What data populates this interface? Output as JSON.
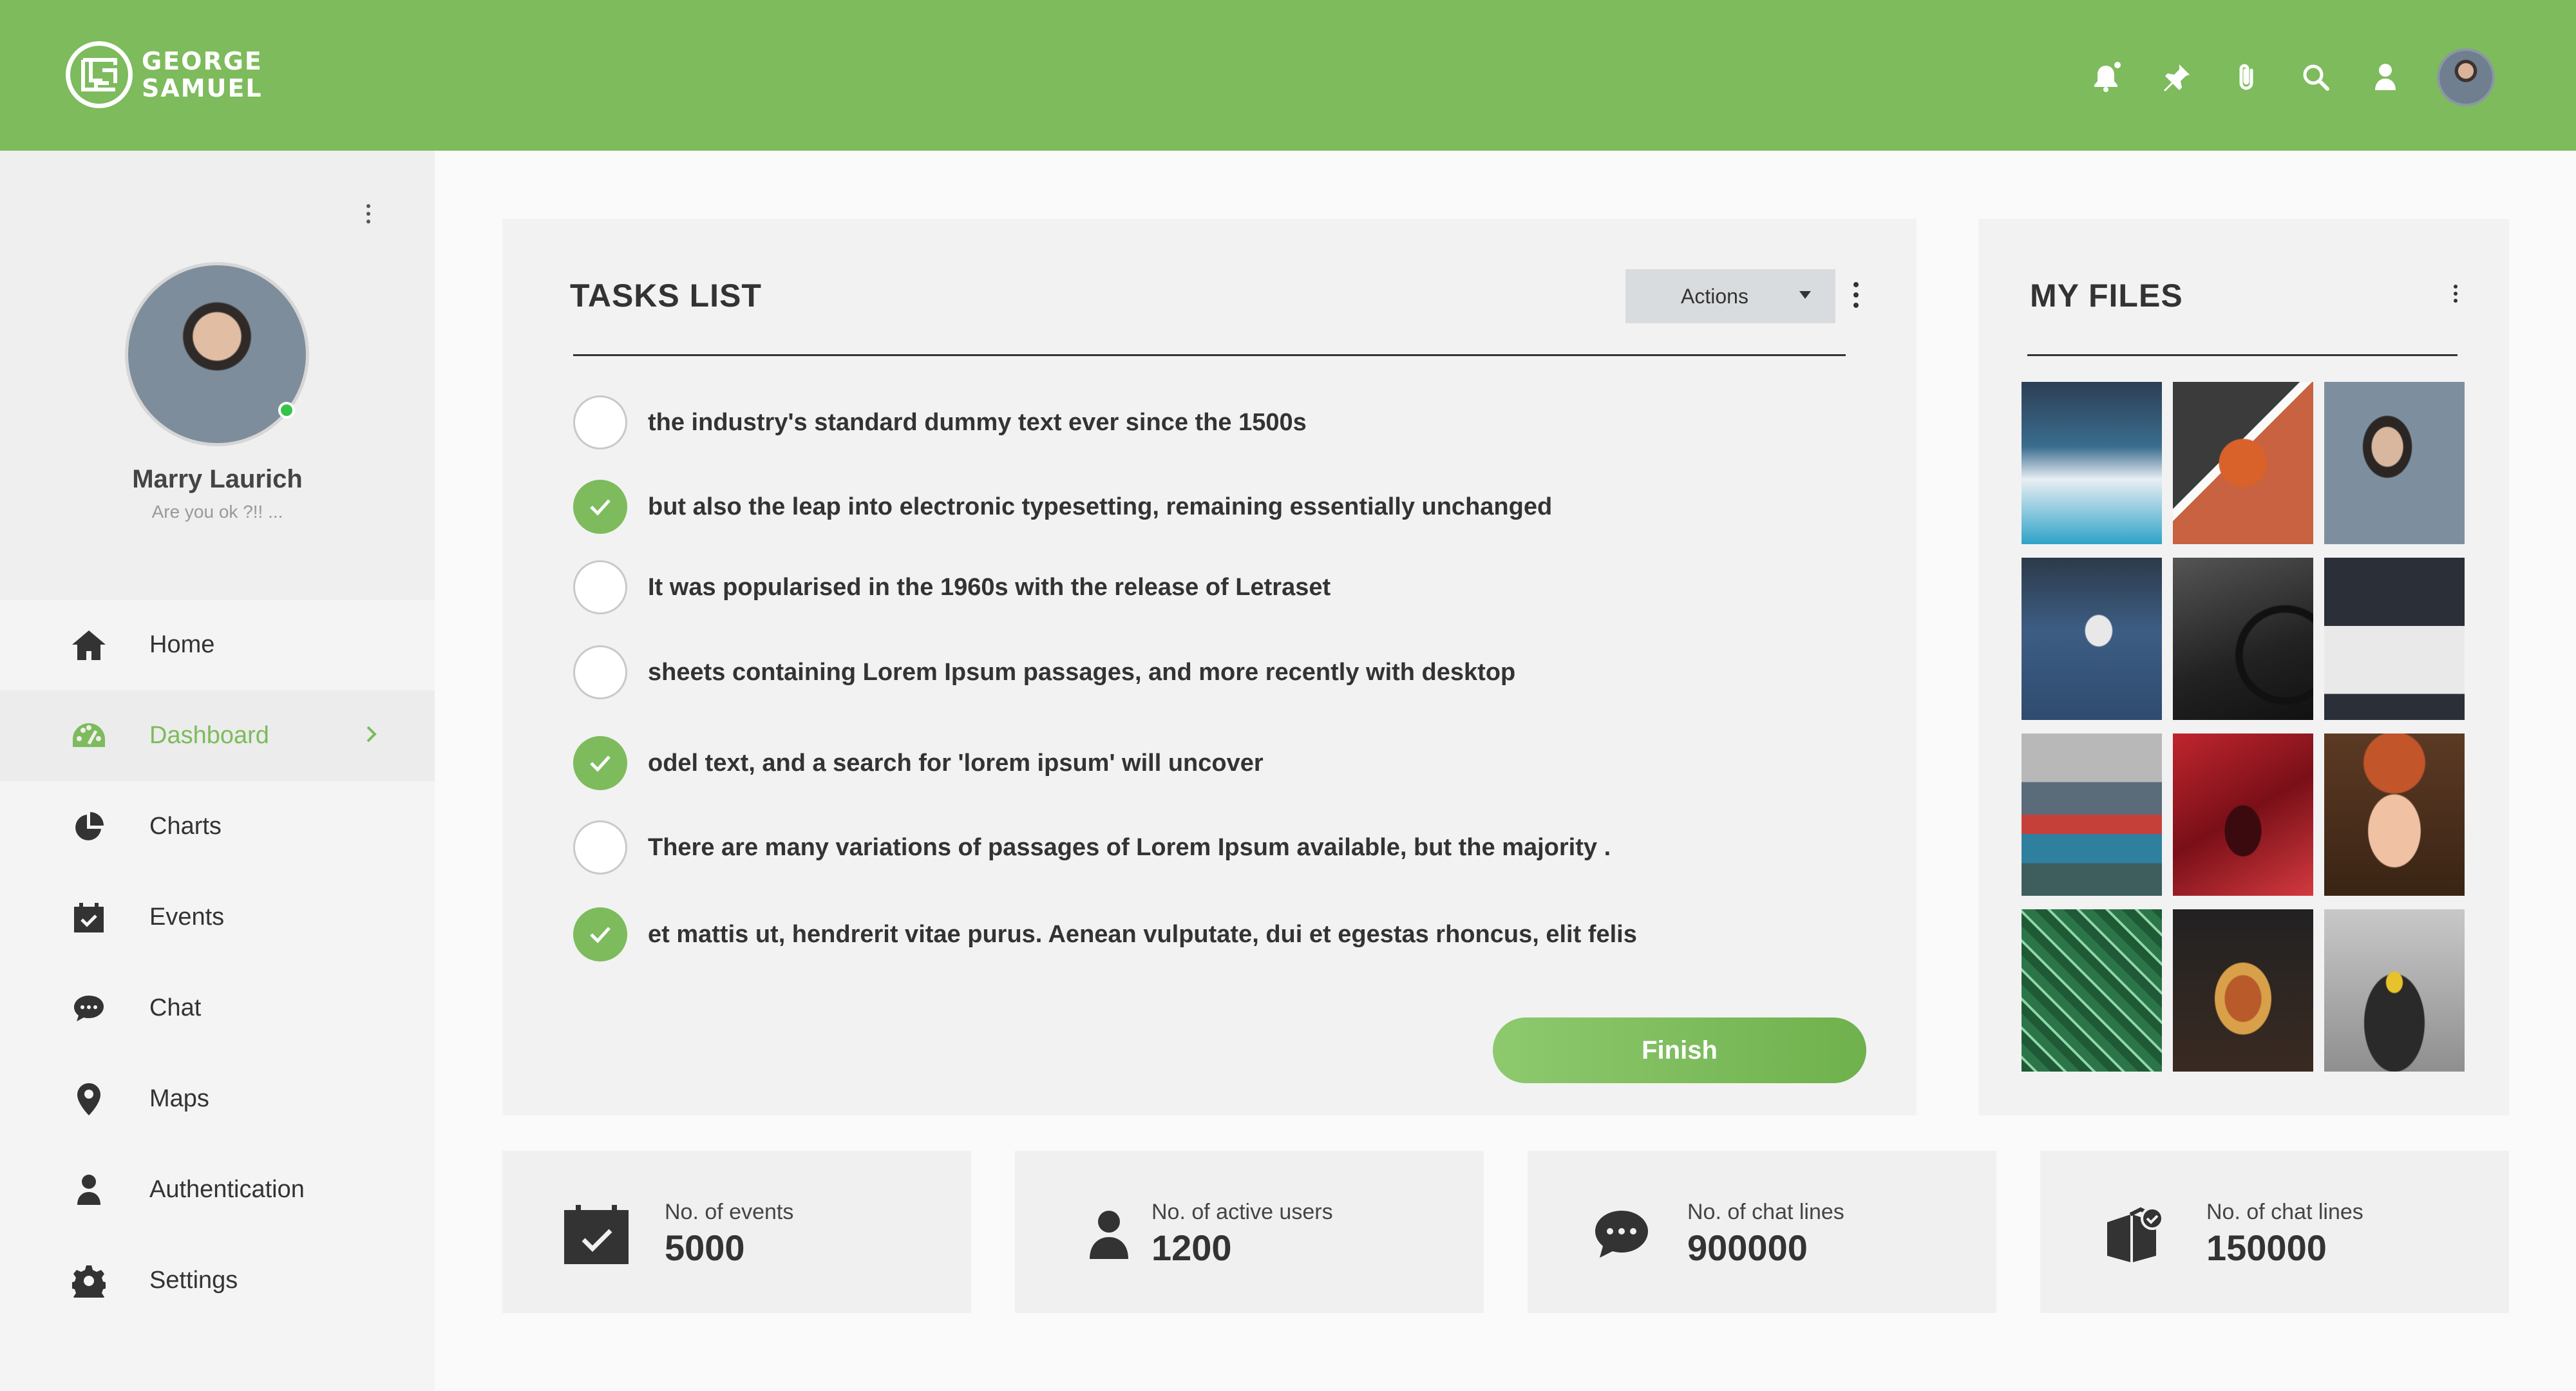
{
  "brand": {
    "line1": "GEORGE",
    "line2": "SAMUEL"
  },
  "header_icons": [
    "bell-icon",
    "pin-icon",
    "paperclip-icon",
    "search-icon",
    "user-icon"
  ],
  "profile": {
    "name": "Marry Laurich",
    "status": "Are you ok ?!! ..."
  },
  "nav": [
    {
      "label": "Home",
      "icon": "home-icon"
    },
    {
      "label": "Dashboard",
      "icon": "dashboard-icon",
      "active": true
    },
    {
      "label": "Charts",
      "icon": "pie-chart-icon"
    },
    {
      "label": "Events",
      "icon": "calendar-check-icon"
    },
    {
      "label": "Chat",
      "icon": "chat-icon"
    },
    {
      "label": "Maps",
      "icon": "map-pin-icon"
    },
    {
      "label": "Authentication",
      "icon": "user-icon"
    },
    {
      "label": "Settings",
      "icon": "gear-icon"
    }
  ],
  "tasks": {
    "title": "TASKS LIST",
    "actions_label": "Actions",
    "items": [
      {
        "text": "the industry's standard dummy text ever since the 1500s",
        "done": false
      },
      {
        "text": "but also the leap into electronic typesetting, remaining essentially unchanged",
        "done": true
      },
      {
        "text": " It was popularised in the 1960s with the release of Letraset",
        "done": false
      },
      {
        "text": "sheets containing Lorem Ipsum passages, and more recently with desktop",
        "done": false
      },
      {
        "text": "odel text, and a search for 'lorem ipsum' will uncover",
        "done": true
      },
      {
        "text": "There are many variations of passages of Lorem Ipsum available, but the majority .",
        "done": false
      },
      {
        "text": "et mattis ut, hendrerit vitae purus. Aenean vulputate, dui et egestas rhoncus, elit felis",
        "done": true
      }
    ],
    "finish_label": "Finish"
  },
  "files": {
    "title": "MY FILES",
    "thumbnails": [
      "scooter-photo",
      "basketball-photo",
      "man-portrait-photo",
      "man-sitting-court-photo",
      "bicycle-photo",
      "think-outside-box-photo",
      "street-mural-photo",
      "neon-red-photo",
      "smiling-woman-photo",
      "green-leaves-photo",
      "burger-photo",
      "car-fog-photo"
    ]
  },
  "stats": [
    {
      "label": "No. of events",
      "value": "5000",
      "icon": "calendar-check-icon"
    },
    {
      "label": "No. of active users",
      "value": "1200",
      "icon": "user-icon"
    },
    {
      "label": "No. of chat lines",
      "value": "900000",
      "icon": "chat-icon"
    },
    {
      "label": "No. of chat lines",
      "value": "150000",
      "icon": "box-check-icon"
    }
  ],
  "colors": {
    "accent": "#7dbb5c",
    "header": "#7dbb5c",
    "online": "#37c34a"
  }
}
